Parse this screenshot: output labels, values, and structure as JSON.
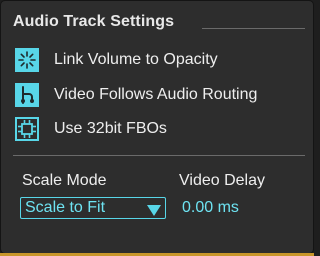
{
  "panel": {
    "title": "Audio Track Settings"
  },
  "options": [
    {
      "label": "Link Volume to Opacity",
      "icon": "link-volume-icon"
    },
    {
      "label": "Video Follows Audio Routing",
      "icon": "routing-icon"
    },
    {
      "label": "Use 32bit FBOs",
      "icon": "chip-icon"
    }
  ],
  "scale_mode": {
    "label": "Scale Mode",
    "value": "Scale to Fit"
  },
  "video_delay": {
    "label": "Video Delay",
    "value": "0.00 ms"
  },
  "colors": {
    "accent": "#58d6e8",
    "accent_text": "#6ee3f2",
    "background": "#2d2d2d",
    "text": "#eeeeee",
    "rule": "#6a6a6a",
    "bottom_bar": "#c8962a"
  }
}
